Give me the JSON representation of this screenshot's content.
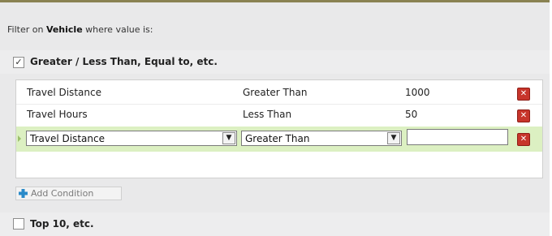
{
  "filter": {
    "prefix": "Filter on ",
    "entity": "Vehicle",
    "suffix": " where value is:"
  },
  "sections": {
    "comparison": {
      "label": "Greater / Less Than, Equal to, etc.",
      "checked": true,
      "check_glyph": "✓"
    },
    "top": {
      "label": "Top 10, etc.",
      "checked": false
    }
  },
  "conditions": [
    {
      "field": "Travel Distance",
      "operator": "Greater Than",
      "value": "1000"
    },
    {
      "field": "Travel Hours",
      "operator": "Less Than",
      "value": "50"
    }
  ],
  "editor": {
    "field": "Travel Distance",
    "operator": "Greater Than",
    "value": "",
    "dropdown_glyph": "▼"
  },
  "delete_glyph": "✕",
  "add_condition_label": "Add Condition",
  "colors": {
    "delete_red": "#c7352b",
    "editing_row_green": "#dcf0c2",
    "add_icon_blue": "#2a8ac9"
  },
  "icons": {
    "delete": "delete-x-icon",
    "add": "plus-icon",
    "dropdown": "chevron-down-icon",
    "check": "checkmark-icon"
  }
}
